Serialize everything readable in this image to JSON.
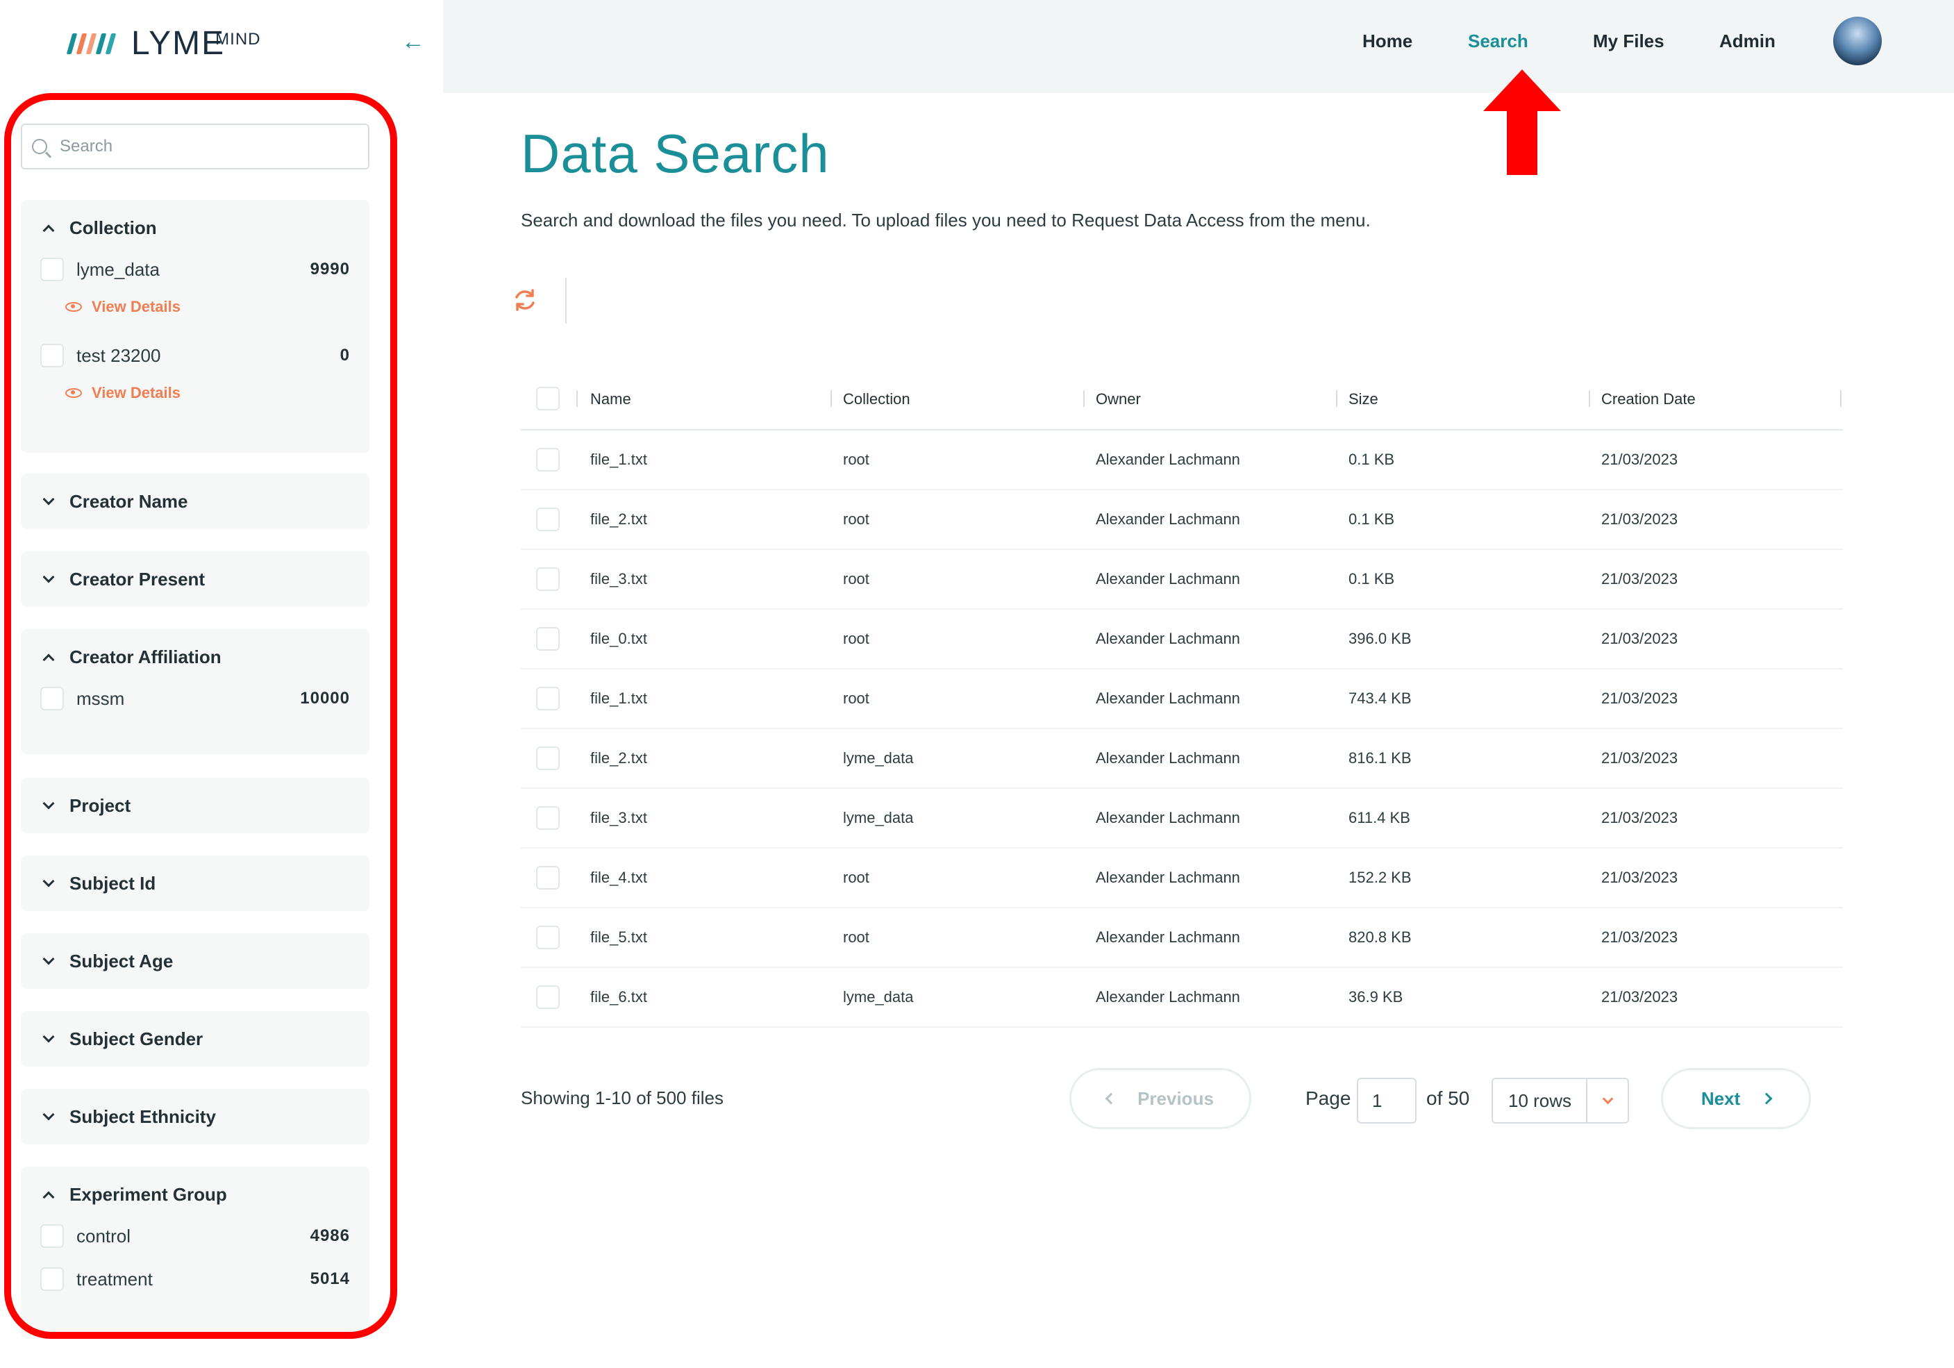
{
  "brand": {
    "name": "LYME",
    "superscript": "MIND",
    "logo_colors": [
      "#1b8f97",
      "#f07e52",
      "#f39b7a",
      "#1b8f97",
      "#2ca5ae"
    ]
  },
  "colors": {
    "accent": "#1b8f97",
    "highlight": "#f07e52",
    "annotation": "#ff0000"
  },
  "nav": {
    "items": [
      {
        "label": "Home",
        "active": false
      },
      {
        "label": "Search",
        "active": true
      },
      {
        "label": "My Files",
        "active": false
      },
      {
        "label": "Admin",
        "active": false
      }
    ]
  },
  "sidebar": {
    "search_placeholder": "Search",
    "view_details_label": "View Details",
    "facets": [
      {
        "title": "Collection",
        "expanded": true,
        "options": [
          {
            "label": "lyme_data",
            "count": "9990",
            "details": true
          },
          {
            "label": "test 23200",
            "count": "0",
            "details": true
          }
        ]
      },
      {
        "title": "Creator Name",
        "expanded": false,
        "options": []
      },
      {
        "title": "Creator Present",
        "expanded": false,
        "options": []
      },
      {
        "title": "Creator Affiliation",
        "expanded": true,
        "options": [
          {
            "label": "mssm",
            "count": "10000",
            "details": false
          }
        ]
      },
      {
        "title": "Project",
        "expanded": false,
        "options": []
      },
      {
        "title": "Subject Id",
        "expanded": false,
        "options": []
      },
      {
        "title": "Subject Age",
        "expanded": false,
        "options": []
      },
      {
        "title": "Subject Gender",
        "expanded": false,
        "options": []
      },
      {
        "title": "Subject Ethnicity",
        "expanded": false,
        "options": []
      },
      {
        "title": "Experiment Group",
        "expanded": true,
        "options": [
          {
            "label": "control",
            "count": "4986",
            "details": false
          },
          {
            "label": "treatment",
            "count": "5014",
            "details": false
          }
        ]
      }
    ]
  },
  "main": {
    "title": "Data Search",
    "subtitle": "Search and download the files you need. To upload files you need to Request Data Access from the menu.",
    "refresh_icon": "refresh-icon",
    "table": {
      "columns": [
        "Name",
        "Collection",
        "Owner",
        "Size",
        "Creation Date"
      ],
      "rows": [
        [
          "file_1.txt",
          "root",
          "Alexander Lachmann",
          "0.1 KB",
          "21/03/2023"
        ],
        [
          "file_2.txt",
          "root",
          "Alexander Lachmann",
          "0.1 KB",
          "21/03/2023"
        ],
        [
          "file_3.txt",
          "root",
          "Alexander Lachmann",
          "0.1 KB",
          "21/03/2023"
        ],
        [
          "file_0.txt",
          "root",
          "Alexander Lachmann",
          "396.0 KB",
          "21/03/2023"
        ],
        [
          "file_1.txt",
          "root",
          "Alexander Lachmann",
          "743.4 KB",
          "21/03/2023"
        ],
        [
          "file_2.txt",
          "lyme_data",
          "Alexander Lachmann",
          "816.1 KB",
          "21/03/2023"
        ],
        [
          "file_3.txt",
          "lyme_data",
          "Alexander Lachmann",
          "611.4 KB",
          "21/03/2023"
        ],
        [
          "file_4.txt",
          "root",
          "Alexander Lachmann",
          "152.2 KB",
          "21/03/2023"
        ],
        [
          "file_5.txt",
          "root",
          "Alexander Lachmann",
          "820.8 KB",
          "21/03/2023"
        ],
        [
          "file_6.txt",
          "lyme_data",
          "Alexander Lachmann",
          "36.9 KB",
          "21/03/2023"
        ]
      ]
    },
    "pagination": {
      "showing": "Showing 1-10 of 500 files",
      "previous": "Previous",
      "next": "Next",
      "page_label": "Page",
      "page_value": "1",
      "of_label": "of 50",
      "rows_per_page": "10 rows"
    }
  }
}
